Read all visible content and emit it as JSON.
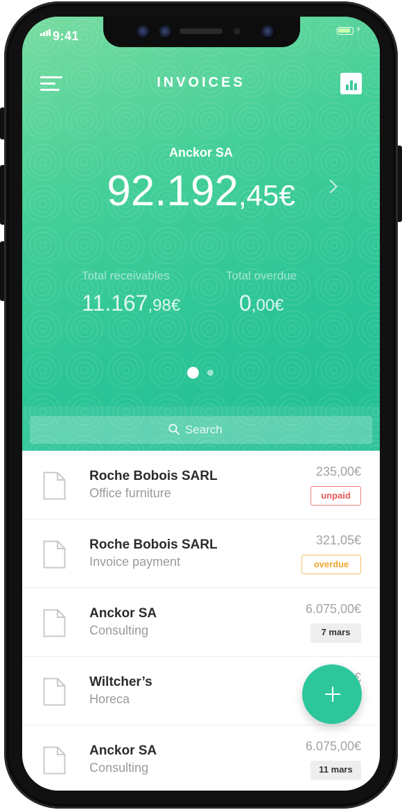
{
  "status_bar": {
    "time": "9:41"
  },
  "header": {
    "title": "INVOICES"
  },
  "summary": {
    "company": "Anckor SA",
    "balance_main": "92.192",
    "balance_decimals": ",45€",
    "receivables_label": "Total receivables",
    "receivables_main": "11.167",
    "receivables_decimals": ",98€",
    "overdue_label": "Total overdue",
    "overdue_main": "0",
    "overdue_decimals": ",00€",
    "pagination": {
      "pages": 2,
      "active": 1
    }
  },
  "search": {
    "placeholder": "Search"
  },
  "invoices": [
    {
      "name": "Roche Bobois SARL",
      "description": "Office furniture",
      "amount": "235,00€",
      "badge": "unpaid",
      "badge_type": "unpaid"
    },
    {
      "name": "Roche Bobois SARL",
      "description": "Invoice payment",
      "amount": "321,05€",
      "badge": "overdue",
      "badge_type": "overdue"
    },
    {
      "name": "Anckor SA",
      "description": "Consulting",
      "amount": "6.075,00€",
      "badge": "7 mars",
      "badge_type": "date"
    },
    {
      "name": "Wiltcher’s",
      "description": "Horeca",
      "amount": "850,00€",
      "badge": "",
      "badge_type": "none"
    },
    {
      "name": "Anckor SA",
      "description": "Consulting",
      "amount": "6.075,00€",
      "badge": "11 mars",
      "badge_type": "date"
    }
  ],
  "colors": {
    "accent": "#2ec79c",
    "unpaid": "#e45a5a",
    "overdue": "#eea72e"
  },
  "icons": {
    "menu": "hamburger-menu-icon",
    "chart": "bar-chart-icon",
    "next": "chevron-right-icon",
    "search": "search-icon",
    "document": "document-icon",
    "add": "plus-icon"
  }
}
